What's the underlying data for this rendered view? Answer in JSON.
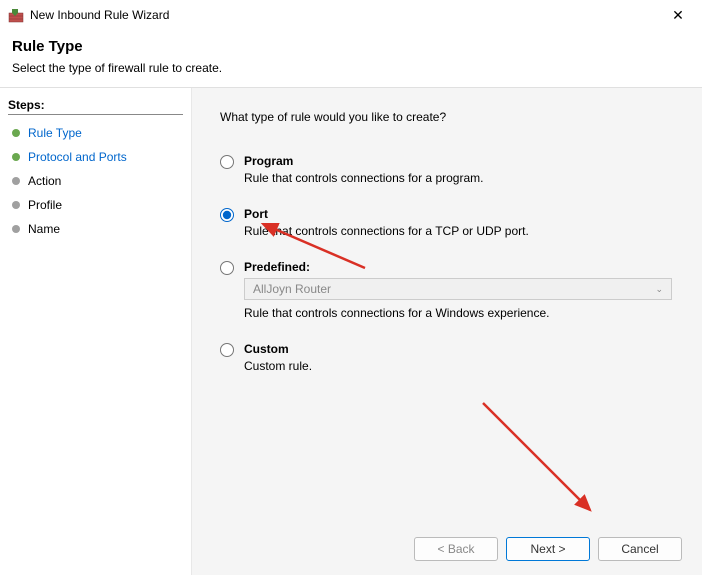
{
  "window": {
    "title": "New Inbound Rule Wizard",
    "close_glyph": "✕"
  },
  "header": {
    "title": "Rule Type",
    "subtitle": "Select the type of firewall rule to create."
  },
  "sidebar": {
    "steps_label": "Steps:",
    "items": [
      {
        "label": "Rule Type",
        "state": "active"
      },
      {
        "label": "Protocol and Ports",
        "state": "active"
      },
      {
        "label": "Action",
        "state": "pending"
      },
      {
        "label": "Profile",
        "state": "pending"
      },
      {
        "label": "Name",
        "state": "pending"
      }
    ]
  },
  "content": {
    "prompt": "What type of rule would you like to create?",
    "options": [
      {
        "key": "program",
        "label": "Program",
        "desc": "Rule that controls connections for a program.",
        "checked": false
      },
      {
        "key": "port",
        "label": "Port",
        "desc": "Rule that controls connections for a TCP or UDP port.",
        "checked": true
      },
      {
        "key": "predefined",
        "label": "Predefined:",
        "desc": "Rule that controls connections for a Windows experience.",
        "checked": false,
        "dropdown_value": "AllJoyn Router"
      },
      {
        "key": "custom",
        "label": "Custom",
        "desc": "Custom rule.",
        "checked": false
      }
    ]
  },
  "buttons": {
    "back": "< Back",
    "next": "Next >",
    "cancel": "Cancel"
  },
  "annotation_color": "#d93025"
}
